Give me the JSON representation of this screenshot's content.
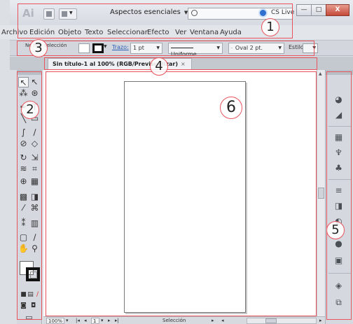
{
  "app": {
    "logo_text": "Ai",
    "workspace_label": "Aspectos esenciales",
    "search_placeholder": "",
    "cslive_label": "CS Live",
    "colors": {
      "annotation": "#e8545d",
      "canvas": "#ffffff",
      "panel": "#d5d9df"
    }
  },
  "window_controls": {
    "minimize": "—",
    "maximize": "□",
    "close": "X"
  },
  "menu": {
    "items": [
      "Archivo",
      "Edición",
      "Objeto",
      "Texto",
      "Seleccionar",
      "Efecto",
      "Ver",
      "Ventana",
      "Ayuda"
    ]
  },
  "controlbar": {
    "selection_label": "No hay selección",
    "stroke_label": "Trazo:",
    "stroke_weight": "1 pt",
    "profile_label": "Uniforme",
    "brush_label": "Oval 2 pt.",
    "style_label": "Estilo"
  },
  "document": {
    "tab_title": "Sin título-1 al 100% (RGB/Previsualizar)",
    "tab_close": "×"
  },
  "statusbar": {
    "zoom": "100%",
    "page": "1",
    "tool_state": "Selección"
  },
  "tools": [
    "selection-icon",
    "direct-selection-icon",
    "magic-wand-icon",
    "lasso-icon",
    "pen-icon",
    "type-icon",
    "line-icon",
    "rectangle-icon",
    "brush-icon",
    "pencil-icon",
    "blob-brush-icon",
    "eraser-icon",
    "rotate-icon",
    "scale-icon",
    "width-icon",
    "free-transform-icon",
    "shape-builder-icon",
    "perspective-icon",
    "mesh-icon",
    "gradient-icon",
    "eyedropper-icon",
    "blend-icon",
    "symbol-sprayer-icon",
    "graph-icon",
    "artboard-icon",
    "slice-icon",
    "hand-icon",
    "zoom-icon"
  ],
  "dock_icons": [
    "color-icon",
    "color-guide-icon",
    "swatches-icon",
    "brushes-icon",
    "symbols-icon",
    "stroke-icon",
    "gradient-panel-icon",
    "transparency-icon",
    "appearance-icon",
    "graphic-styles-icon",
    "layers-icon",
    "artboards-panel-icon"
  ],
  "annotations": [
    "1",
    "2",
    "3",
    "4",
    "5",
    "6"
  ]
}
